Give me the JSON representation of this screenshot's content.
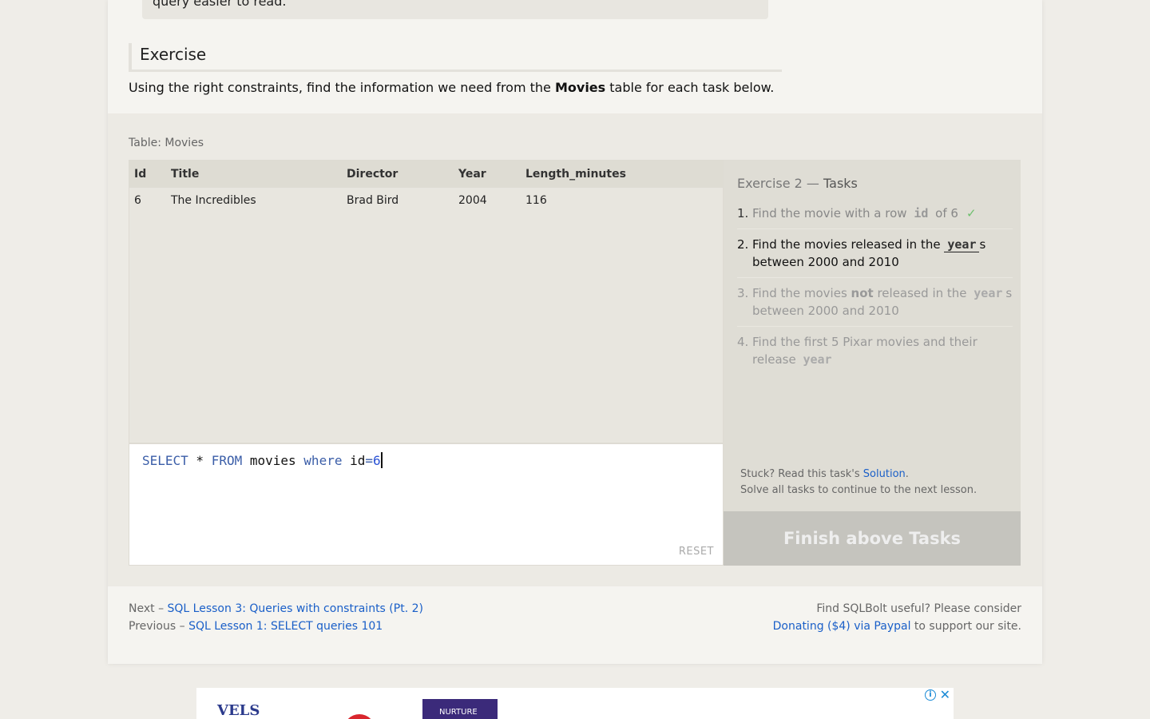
{
  "prev_note": "query easier to read.",
  "exercise": {
    "heading": "Exercise",
    "intro_before": "Using the right constraints, find the information we need from the ",
    "intro_bold": "Movies",
    "intro_after": " table for each task below."
  },
  "table": {
    "caption": "Table: Movies",
    "columns": [
      "Id",
      "Title",
      "Director",
      "Year",
      "Length_minutes"
    ],
    "rows": [
      [
        "6",
        "The Incredibles",
        "Brad Bird",
        "2004",
        "116"
      ]
    ]
  },
  "editor": {
    "kw_select": "SELECT",
    "star": " * ",
    "kw_from": "FROM",
    "table": " movies ",
    "kw_where": "where",
    "col": " id",
    "op": "=",
    "value": "6",
    "reset_label": "RESET"
  },
  "tasks": {
    "title_prefix": "Exercise 2 — ",
    "title_suffix": "Tasks",
    "items": [
      {
        "n": "1.",
        "before": "Find the movie with a row ",
        "code": "id",
        "after": " of 6",
        "state": "complete",
        "check": "✓"
      },
      {
        "n": "2.",
        "before": "Find the movies released in the ",
        "code": "year",
        "after": "s between 2000 and 2010",
        "state": "active"
      },
      {
        "n": "3.",
        "before": "Find the movies ",
        "bold": "not",
        "mid": " released in the ",
        "code": "year",
        "after": "s between 2000 and 2010",
        "state": "pending"
      },
      {
        "n": "4.",
        "before": "Find the first 5 Pixar movies and their release ",
        "code": "year",
        "after": "",
        "state": "pending"
      }
    ],
    "stuck_text": "Stuck? Read this task's ",
    "solution_link": "Solution",
    "stuck_period": ".",
    "continue_text": "Solve all tasks to continue to the next lesson.",
    "finish_label": "Finish above Tasks"
  },
  "nav": {
    "next_label": "Next – ",
    "next_link": "SQL Lesson 3: Queries with constraints (Pt. 2)",
    "prev_label": "Previous – ",
    "prev_link": "SQL Lesson 1: SELECT queries 101",
    "support_line1": "Find SQLBolt useful? Please consider",
    "donate_link": "Donating ($4) via Paypal",
    "support_line2_after": " to support our site."
  },
  "ad": {
    "logo_text": "VELS",
    "banner_text": "NURTURE"
  }
}
